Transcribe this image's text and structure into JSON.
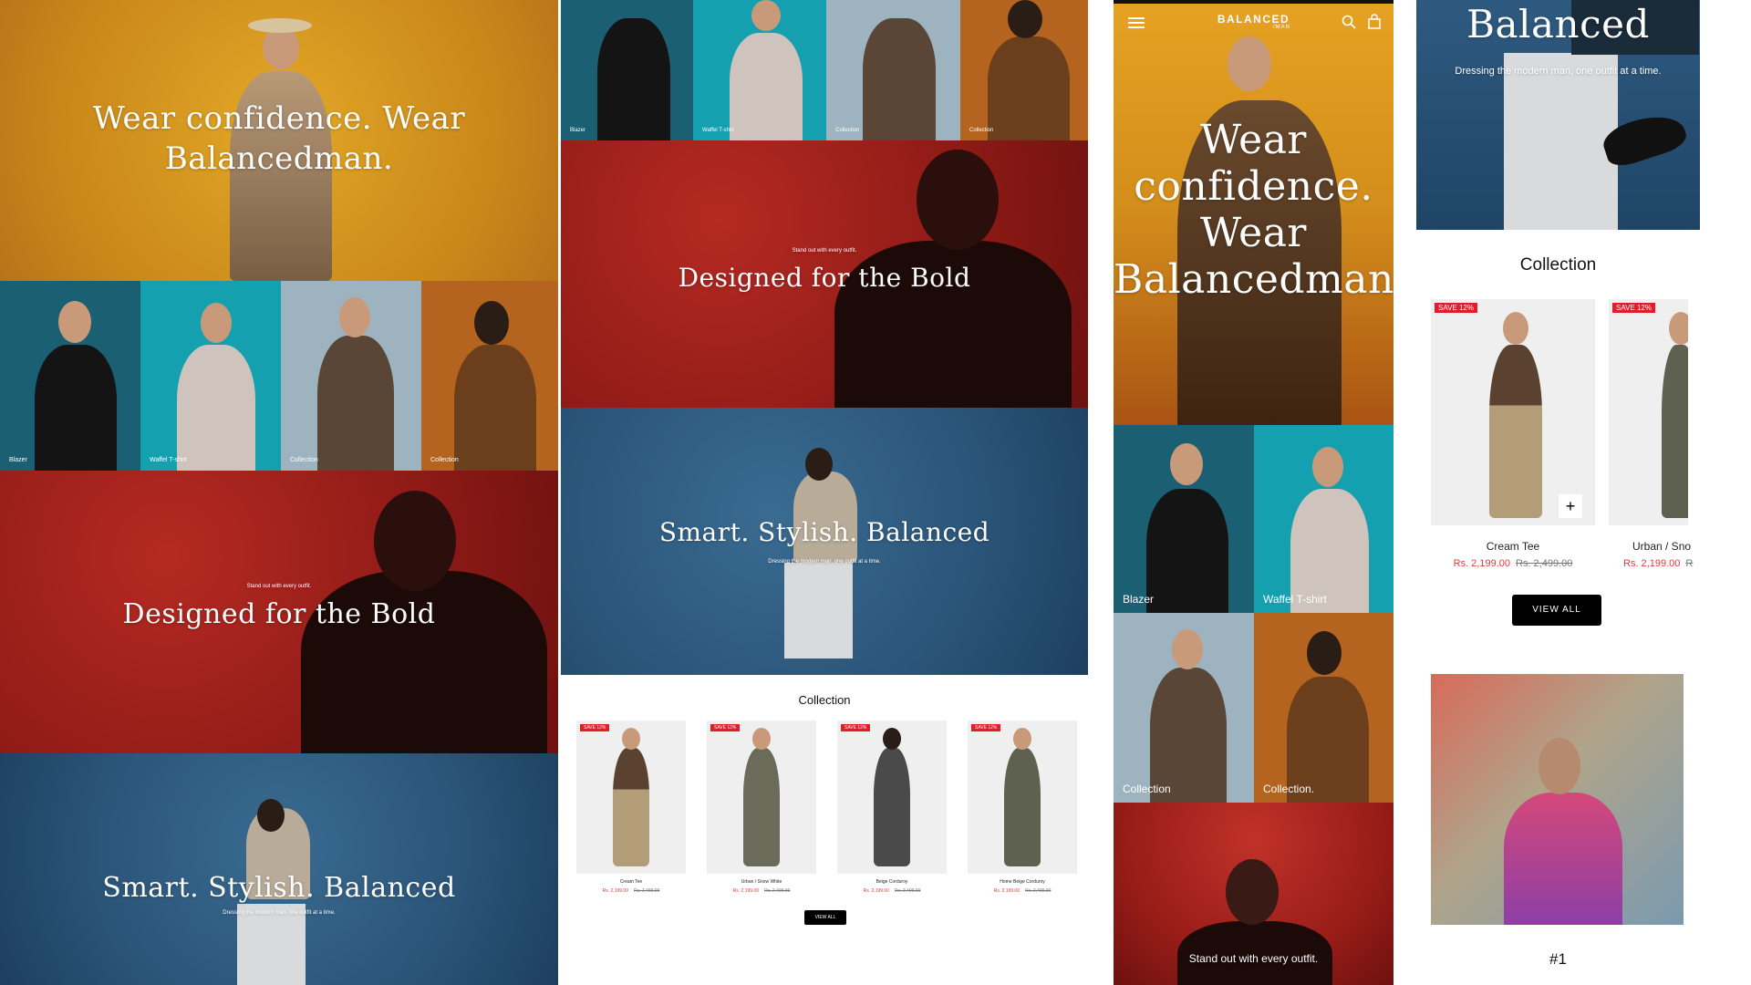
{
  "brand": {
    "name": "BALANCED",
    "sub": "/MAN"
  },
  "hero": {
    "desktop_title_line1": "Wear confidence. Wear",
    "desktop_title_line2": "Balancedman.",
    "mobile_lines": [
      "Wear",
      "confidence.",
      "Wear",
      "Balancedman."
    ]
  },
  "categories": [
    "Blazer",
    "Waffel T-shirt",
    "Collection",
    "Collection"
  ],
  "mobile_categories": [
    "Blazer",
    "Waffel T-shirt",
    "Collection",
    "Collection."
  ],
  "bold": {
    "eyebrow": "Stand out with every outfit.",
    "title": "Designed for the Bold"
  },
  "smart": {
    "title": "Smart. Stylish. Balanced",
    "subtitle": "Dressing the modern man, one outfit at a time."
  },
  "mobile_smart_title": "Balanced",
  "collection": {
    "title": "Collection",
    "view_all": "VIEW ALL",
    "badge": "SAVE 12%",
    "products": [
      {
        "name": "Cream Tee",
        "price": "Rs. 2,199.00",
        "old_price": "Rs. 2,499.00"
      },
      {
        "name": "Urban / Snow White",
        "price": "Rs. 2,199.00",
        "old_price": "Rs. 2,499.00"
      },
      {
        "name": "Beige Corduroy",
        "price": "Rs. 2,199.00",
        "old_price": "Rs. 2,499.00"
      },
      {
        "name": "Home Beige Corduroy",
        "price": "Rs. 2,199.00",
        "old_price": "Rs. 2,499.00"
      }
    ],
    "mobile_products": [
      {
        "name": "Cream Tee",
        "price": "Rs. 2,199.00",
        "old_price": "Rs. 2,499.00"
      },
      {
        "name": "Urban / Sno",
        "price": "Rs. 2,199.00",
        "old_price": "R"
      }
    ]
  },
  "mobile_stand_out": "Stand out with every outfit.",
  "feature_number": "#1",
  "icons": {
    "menu": "menu-icon",
    "search": "search-icon",
    "bag": "bag-icon",
    "plus": "plus-icon"
  },
  "colors": {
    "mustard": "#d39a1e",
    "red": "#8e1a16",
    "blue": "#2a5478",
    "teal": "#1597a6",
    "black": "#000000",
    "sale": "#e21d2b"
  }
}
